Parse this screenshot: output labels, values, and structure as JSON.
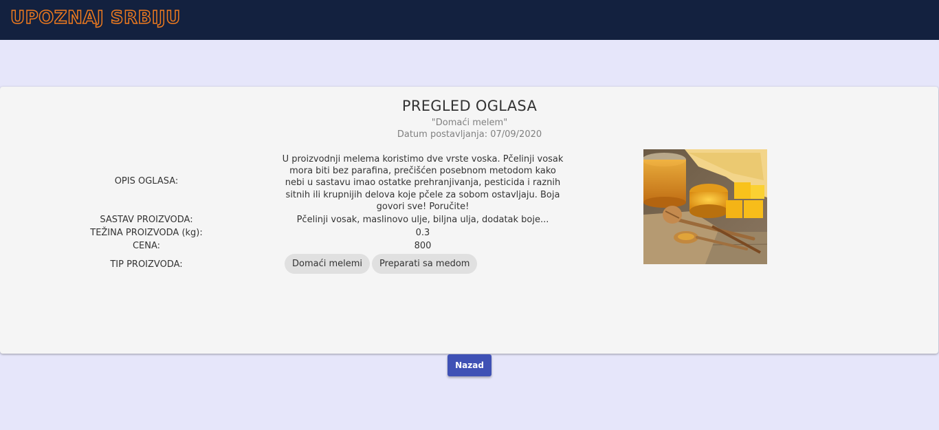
{
  "app": {
    "logo_text": "UPOZNAJ SRBIJU"
  },
  "ad": {
    "title": "PREGLED OGLASA",
    "name": "\"Domaći melem\"",
    "date": "Datum postavljanja: 07/09/2020",
    "description_label": "OPIS OGLASA:",
    "description": "U proizvodnji melema koristimo dve vrste voska. Pčelinji vosak mora biti bez parafina, prečišćen posebnom metodom kako nebi u sastavu imao ostatke prehranjivanja, pesticida i raznih sitnih ili krupnijih delova koje pčele za sobom ostavljaju. Boja govori sve! Poručite!",
    "composition_label": "SASTAV PROIZVODA:",
    "composition": "Pčelinji vosak, maslinovo ulje, biljna ulja, dodatak boje...",
    "weight_label": "TEŽINA PROIZVODA (kg):",
    "weight": "0.3",
    "price_label": "CENA:",
    "price": "800",
    "type_label": "TIP PROIZVODA:",
    "types": [
      "Domaći melemi",
      "Preparati sa medom"
    ]
  },
  "actions": {
    "back_label": "Nazad"
  },
  "colors": {
    "header_bg": "#13213f",
    "logo_accent": "#f07b1e",
    "page_bg": "#e6e6fa",
    "button_primary": "#3f51b5"
  }
}
